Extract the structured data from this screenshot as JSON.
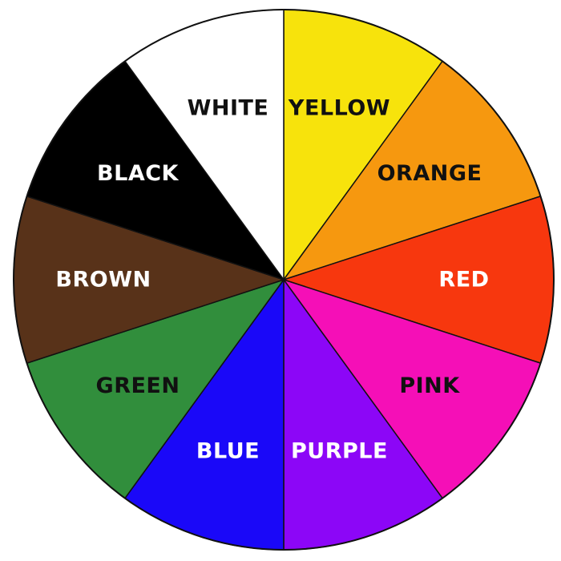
{
  "wheel": {
    "outline_color": "#111111",
    "segments": [
      {
        "label": "YELLOW",
        "color": "#f7e30c",
        "text_color": "#111111"
      },
      {
        "label": "ORANGE",
        "color": "#f6980f",
        "text_color": "#111111"
      },
      {
        "label": "RED",
        "color": "#f7370e",
        "text_color": "#ffffff"
      },
      {
        "label": "PINK",
        "color": "#f50fb7",
        "text_color": "#111111"
      },
      {
        "label": "PURPLE",
        "color": "#8c06f7",
        "text_color": "#ffffff"
      },
      {
        "label": "BLUE",
        "color": "#1a08f8",
        "text_color": "#ffffff"
      },
      {
        "label": "GREEN",
        "color": "#318e3c",
        "text_color": "#111111"
      },
      {
        "label": "BROWN",
        "color": "#583219",
        "text_color": "#ffffff"
      },
      {
        "label": "BLACK",
        "color": "#000000",
        "text_color": "#ffffff"
      },
      {
        "label": "WHITE",
        "color": "#ffffff",
        "text_color": "#111111"
      }
    ]
  }
}
